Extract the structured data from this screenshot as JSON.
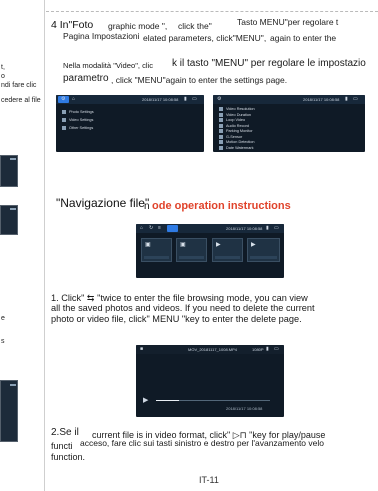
{
  "left_column": {
    "fragments": [
      "t,",
      "o",
      "ndi fare clic",
      "cedere al file",
      "e",
      "s"
    ]
  },
  "step4": {
    "heading_parts": [
      "4 In\"Foto",
      "graphic mode \",",
      "click the\"",
      "Tasto MENU\"per regolare t"
    ],
    "line2_parts": [
      "Pagina Impostazioni",
      "elated parameters, click\"MENU\",",
      "again to enter the"
    ],
    "video_line_parts": [
      "Nella modalità \"Video\", clic",
      "k il tasto \"MENU\" per regolare le impostazio"
    ],
    "line4_parts": [
      "parametro",
      ", click \"MENU\"again to enter the settings page."
    ]
  },
  "settings_left": {
    "time": "2018/11/17 10:08:58",
    "items": [
      "Photo Settings",
      "Video Settings",
      "Other Settings"
    ]
  },
  "settings_right": {
    "time": "2018/11/17 10:08:58",
    "items": [
      "Video Resolution",
      "Video Duration",
      "Loop Video",
      "Audio Record",
      "Parking Monitor",
      "G-Sensor",
      "Motion Detection",
      "Date Watermark"
    ]
  },
  "section": {
    "title_left": "\"Navigazione file\"",
    "title_connector": "n",
    "title_right": "ode operation instructions"
  },
  "browser": {
    "time": "2018/11/17 10:08:58",
    "tiles": [
      {
        "icon": "▣",
        "label": "FILE_20181117_1008"
      },
      {
        "icon": "▣",
        "label": "FILE_20181117_1009"
      },
      {
        "icon": "▶",
        "label": "MOV_20181117_1010"
      },
      {
        "icon": "▶",
        "label": "MOV_20181117_1011"
      }
    ]
  },
  "step1": {
    "lines": [
      "1. Click\" ⇆ \"twice to enter the file browsing mode, you can view",
      "all the saved photos and videos. If you need to delete the current",
      "photo or video file, click\" MENU \"key to enter the delete page."
    ]
  },
  "player": {
    "filename": "MOV_20181117_1008.MP4",
    "time_label": "2018/11/17 10:08:58",
    "size_label": "1080P",
    "progress": 0.2
  },
  "step2": {
    "line1_parts": [
      "2.Se il",
      "current file is in video format, click\" ▷⊓ \"key for play/pause"
    ],
    "line2_parts": [
      "functi",
      "acceso, fare clic sui tasti sinistro e destro per l'avanzamento velo"
    ],
    "line3": "function."
  },
  "footer": {
    "page_number": "IT-11"
  }
}
